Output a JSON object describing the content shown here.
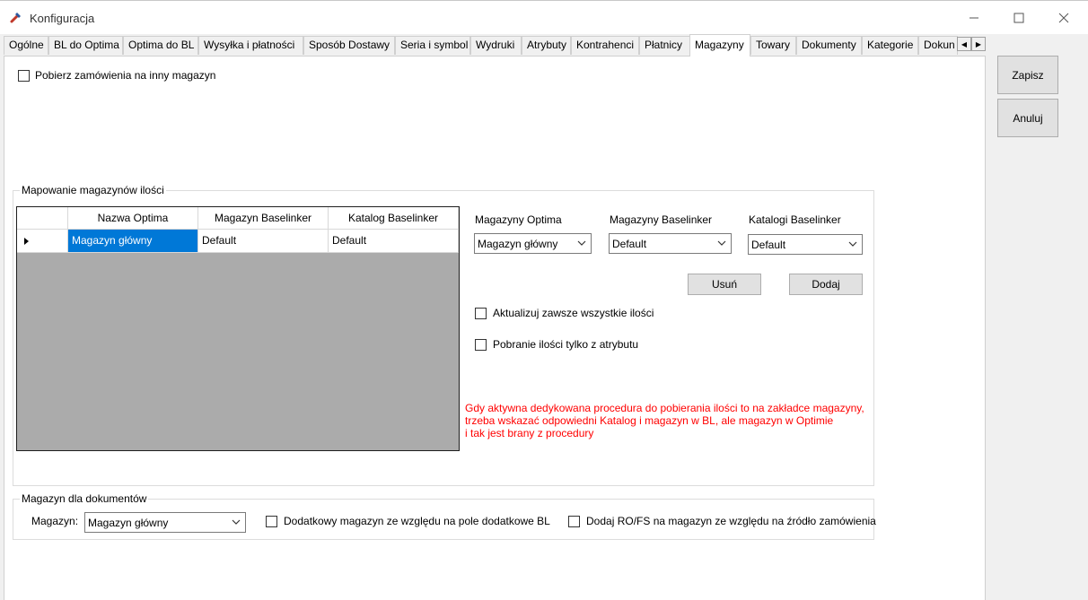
{
  "window": {
    "title": "Konfiguracja",
    "icon": "wrench-icon",
    "controls": [
      "minimize-icon",
      "maximize-icon",
      "close-icon"
    ]
  },
  "tabs": [
    {
      "label": "Ogólne"
    },
    {
      "label": "BL do Optima"
    },
    {
      "label": "Optima do BL"
    },
    {
      "label": "Wysyłka i płatności"
    },
    {
      "label": "Sposób Dostawy"
    },
    {
      "label": "Seria i symbol"
    },
    {
      "label": "Wydruki"
    },
    {
      "label": "Atrybuty"
    },
    {
      "label": "Kontrahenci"
    },
    {
      "label": "Płatnicy"
    },
    {
      "label": "Magazyny",
      "active": true
    },
    {
      "label": "Towary"
    },
    {
      "label": "Dokumenty"
    },
    {
      "label": "Kategorie"
    },
    {
      "label": "Dokun"
    }
  ],
  "top_checkbox": {
    "label": "Pobierz zamówienia na inny magazyn",
    "checked": false
  },
  "mapping_group": {
    "title": "Mapowanie magazynów ilości",
    "grid": {
      "columns": [
        "Nazwa Optima",
        "Magazyn Baselinker",
        "Katalog Baselinker"
      ],
      "rows": [
        {
          "cells": [
            "Magazyn główny",
            "Default",
            "Default"
          ],
          "selected": true
        }
      ]
    },
    "magazyny_optima": {
      "label": "Magazyny Optima",
      "value": "Magazyn główny"
    },
    "magazyny_baselinker": {
      "label": "Magazyny Baselinker",
      "value": "Default"
    },
    "katalogi_baselinker": {
      "label": "Katalogi Baselinker",
      "value": "Default"
    },
    "usun_label": "Usuń",
    "dodaj_label": "Dodaj",
    "chk_aktualizuj": {
      "label": "Aktualizuj zawsze wszystkie ilości",
      "checked": false
    },
    "chk_pobranie": {
      "label": "Pobranie ilości tylko z atrybutu",
      "checked": false
    },
    "note": {
      "lines": [
        "Gdy aktywna dedykowana procedura do pobierania ilości to na zakładce magazyny,",
        "trzeba wskazać odpowiedni Katalog i magazyn w BL, ale magazyn w Optimie",
        "i tak jest brany z procedury"
      ],
      "color": "#ff0000"
    }
  },
  "documents_group": {
    "title": "Magazyn dla dokumentów",
    "magazyn_label": "Magazyn:",
    "magazyn_value": "Magazyn główny",
    "chk_dodatkowy": {
      "label": "Dodatkowy magazyn ze względu na pole dodatkowe BL",
      "checked": false
    },
    "chk_ro_fs": {
      "label": "Dodaj RO/FS na magazyn ze względu na źródło zamówienia",
      "checked": false
    }
  },
  "side_buttons": {
    "save": "Zapisz",
    "cancel": "Anuluj"
  },
  "colors": {
    "selection": "#0078d7",
    "grid_empty": "#ababab",
    "note": "#ff0000"
  }
}
